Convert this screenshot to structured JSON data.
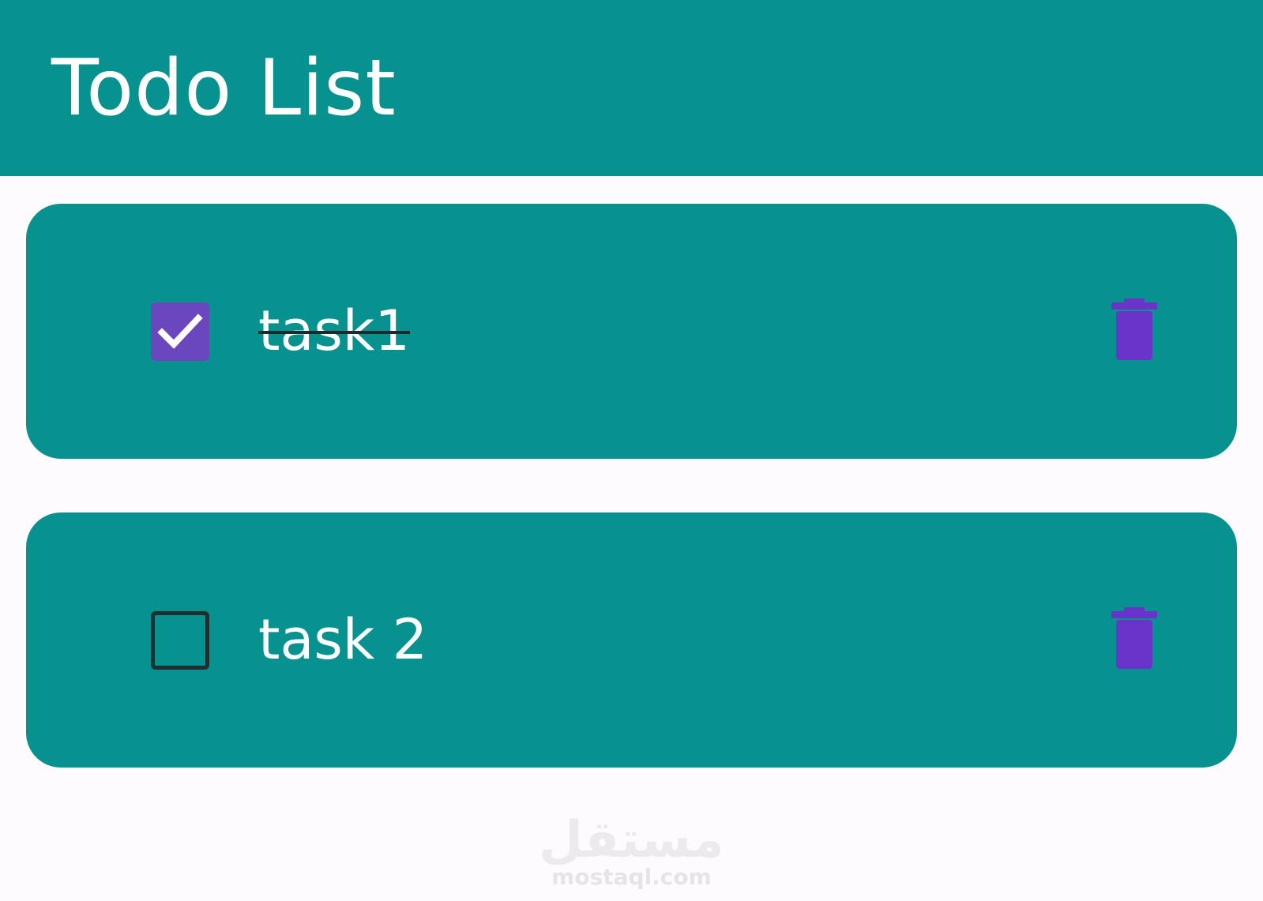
{
  "app_bar": {
    "title": "Todo List",
    "background": "#07928f"
  },
  "todos": [
    {
      "label": "task1",
      "completed": true,
      "checkbox_icon": "checkmark-icon",
      "delete_icon": "trash-icon"
    },
    {
      "label": "task 2",
      "completed": false,
      "checkbox_icon": "empty-checkbox",
      "delete_icon": "trash-icon"
    }
  ],
  "watermark": {
    "logo_text": "مستقل",
    "url": "mostaql.com"
  },
  "colors": {
    "accent": "#6a47bf",
    "card": "#07928f",
    "background": "#fdfbfe",
    "text": "#ffffff"
  }
}
